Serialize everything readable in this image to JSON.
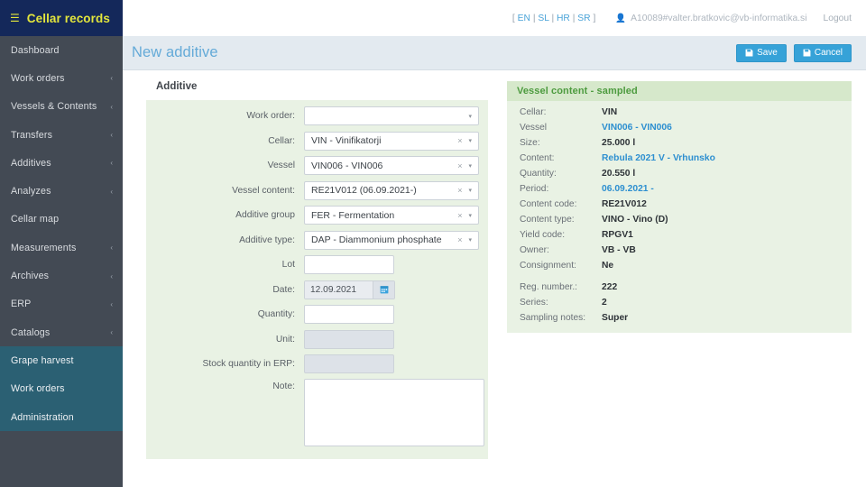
{
  "brand": {
    "burger_icon": "hamburger-icon",
    "title": "Cellar records"
  },
  "sidebar": {
    "items": [
      {
        "label": "Dashboard",
        "chevron": "",
        "active": false
      },
      {
        "label": "Work orders",
        "chevron": "‹",
        "active": false
      },
      {
        "label": "Vessels & Contents",
        "chevron": "‹",
        "active": false
      },
      {
        "label": "Transfers",
        "chevron": "‹",
        "active": false
      },
      {
        "label": "Additives",
        "chevron": "‹",
        "active": false
      },
      {
        "label": "Analyzes",
        "chevron": "‹",
        "active": false
      },
      {
        "label": "Cellar map",
        "chevron": "",
        "active": false
      },
      {
        "label": "Measurements",
        "chevron": "‹",
        "active": false
      },
      {
        "label": "Archives",
        "chevron": "‹",
        "active": false
      },
      {
        "label": "ERP",
        "chevron": "‹",
        "active": false
      },
      {
        "label": "Catalogs",
        "chevron": "‹",
        "active": false
      },
      {
        "label": "Grape harvest",
        "chevron": "",
        "active": true
      },
      {
        "label": "Work orders",
        "chevron": "",
        "active": true
      },
      {
        "label": "Administration",
        "chevron": "",
        "active": true
      }
    ]
  },
  "header": {
    "lang_open": "[ ",
    "lang_close": " ]",
    "languages": [
      "EN",
      "SL",
      "HR",
      "SR"
    ],
    "lang_sep": " | ",
    "user_icon": "user-icon",
    "user": "A10089#valter.bratkovic@vb-informatika.si",
    "logout": "Logout"
  },
  "page": {
    "title": "New additive",
    "save_label": "Save",
    "cancel_label": "Cancel"
  },
  "form": {
    "legend": "Additive",
    "fields": [
      {
        "label": "Work order:",
        "type": "select",
        "value": "",
        "clear": "",
        "caret": "▾"
      },
      {
        "label": "Cellar:",
        "type": "select",
        "value": "VIN - Vinifikatorji",
        "clear": "×",
        "caret": "▾"
      },
      {
        "label": "Vessel",
        "type": "select",
        "value": "VIN006 - VIN006",
        "clear": "×",
        "caret": "▾"
      },
      {
        "label": "Vessel content:",
        "type": "select",
        "value": "RE21V012 (06.09.2021-)",
        "clear": "×",
        "caret": "▾"
      },
      {
        "label": "Additive group",
        "type": "select",
        "value": "FER - Fermentation",
        "clear": "×",
        "caret": "▾"
      },
      {
        "label": "Additive type:",
        "type": "select",
        "value": "DAP - Diammonium phosphate",
        "clear": "×",
        "caret": "▾"
      },
      {
        "label": "Lot",
        "type": "text",
        "value": ""
      },
      {
        "label": "Date:",
        "type": "date",
        "value": "12.09.2021",
        "icon": "calendar-icon"
      },
      {
        "label": "Quantity:",
        "type": "text",
        "value": ""
      },
      {
        "label": "Unit:",
        "type": "disabled",
        "value": ""
      },
      {
        "label": "Stock quantity in ERP:",
        "type": "disabled",
        "value": ""
      },
      {
        "label": "Note:",
        "type": "textarea",
        "value": ""
      }
    ]
  },
  "info": {
    "title": "Vessel content - sampled",
    "rows": [
      {
        "label": "Cellar:",
        "value": "VIN",
        "link": false
      },
      {
        "label": "Vessel",
        "value": "VIN006 - VIN006",
        "link": true
      },
      {
        "label": "Size:",
        "value": "25.000 l",
        "link": false
      },
      {
        "label": "Content:",
        "value": "Rebula 2021 V - Vrhunsko",
        "link": true
      },
      {
        "label": "Quantity:",
        "value": "20.550 l",
        "link": false
      },
      {
        "label": "Period:",
        "value": "06.09.2021 -",
        "link": true
      },
      {
        "label": "Content code:",
        "value": "RE21V012",
        "link": false
      },
      {
        "label": "Content type:",
        "value": "VINO - Vino (D)",
        "link": false
      },
      {
        "label": "Yield code:",
        "value": "RPGV1",
        "link": false
      },
      {
        "label": "Owner:",
        "value": "VB - VB",
        "link": false
      },
      {
        "label": "Consignment:",
        "value": "Ne",
        "link": false
      },
      {
        "label": "",
        "value": "",
        "gap": true
      },
      {
        "label": "Reg. number.:",
        "value": "222",
        "link": false
      },
      {
        "label": "Series:",
        "value": "2",
        "link": false
      },
      {
        "label": "Sampling notes:",
        "value": "Super",
        "link": false
      }
    ]
  },
  "colors": {
    "brand_bg": "#14285a",
    "brand_text": "#e3e63c",
    "sidebar_bg": "#434a54",
    "sidebar_active": "#2b6073",
    "accent_blue": "#36a2d8",
    "title_blue": "#64aad8",
    "panel_green": "#e9f2e4",
    "panel_head_green": "#d6e8cb",
    "panel_head_text": "#4d9b3f",
    "pagebar_bg": "#e3eaf0"
  }
}
